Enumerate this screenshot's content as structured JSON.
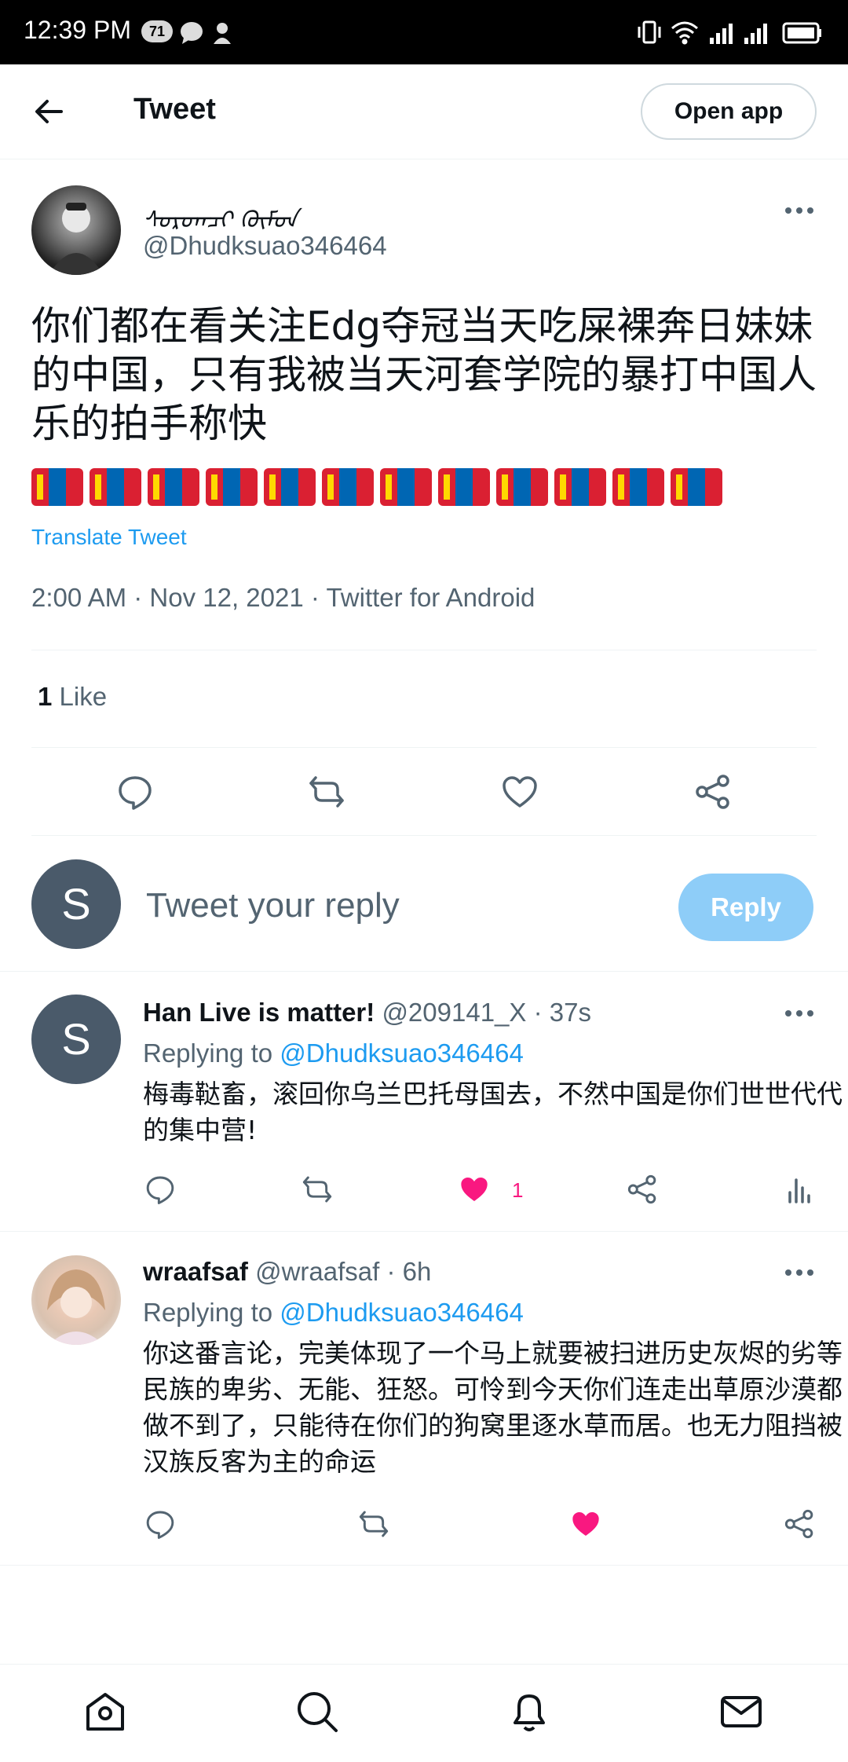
{
  "status_bar": {
    "time": "12:39 PM",
    "badge": "71"
  },
  "header": {
    "title": "Tweet",
    "open_app": "Open app"
  },
  "tweet": {
    "author_name": "ᠰᠤᠷᠤᠭᠴᠢ ᠬᠦᠮᠦᠨ",
    "author_handle": "@Dhudksuao346464",
    "text": "你们都在看关注Edg夺冠当天吃屎裸奔日妹妹的中国，只有我被当天河套学院的暴打中国人乐的拍手称快",
    "flags_count": 12,
    "translate": "Translate Tweet",
    "meta": "2:00 AM · Nov 12, 2021 · Twitter for Android",
    "likes_count": "1",
    "likes_label": "Like"
  },
  "compose": {
    "avatar_letter": "S",
    "placeholder": "Tweet your reply",
    "reply_button": "Reply"
  },
  "replies": [
    {
      "avatar_letter": "S",
      "name": "Han Live is matter!",
      "handle_time": "@209141_X · 37s",
      "replying_prefix": "Replying to",
      "mention": "@Dhudksuao346464",
      "text": "梅毒鞑畜，滚回你乌兰巴托母国去，不然中国是你们世世代代的集中营!",
      "like_count": "1"
    },
    {
      "name": "wraafsaf",
      "handle_time": "@wraafsaf · 6h",
      "replying_prefix": "Replying to",
      "mention": "@Dhudksuao346464",
      "text": "你这番言论，完美体现了一个马上就要被扫进历史灰烬的劣等民族的卑劣、无能、狂怒。可怜到今天你们连走出草原沙漠都做不到了，只能待在你们的狗窝里逐水草而居。也无力阻挡被汉族反客为主的命运"
    }
  ],
  "colors": {
    "accent": "#1d9bf0",
    "like": "#f91880",
    "muted": "#536471",
    "reply_button": "#8ecdf8"
  }
}
